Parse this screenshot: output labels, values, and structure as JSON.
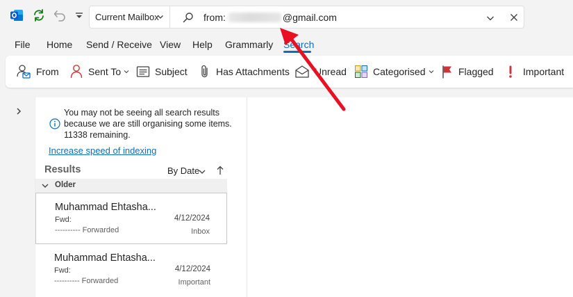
{
  "colors": {
    "accent": "#0f6cbd",
    "annotation_red": "#e81123",
    "outlook_blue": "#0a5fc6",
    "sync_green": "#107c10",
    "flag_red": "#d13438"
  },
  "titlebar": {
    "mailbox_scope": "Current Mailbox",
    "search": {
      "prefix": "from:",
      "redacted_part": "",
      "suffix": "@gmail.com"
    }
  },
  "menu": {
    "tabs": [
      "File",
      "Home",
      "Send / Receive",
      "View",
      "Help",
      "Grammarly",
      "Search"
    ],
    "active": "Search"
  },
  "ribbon": {
    "from": "From",
    "sent_to": "Sent To",
    "subject": "Subject",
    "has_attachments": "Has Attachments",
    "unread": "Unread",
    "categorised": "Categorised",
    "flagged": "Flagged",
    "important": "Important"
  },
  "list": {
    "info_message": "You may not be seeing all search results because we are still organising some items. 11338 remaining.",
    "speed_link": "Increase speed of indexing",
    "results_title": "Results",
    "sort_label": "By Date",
    "group_label": "Older",
    "messages": [
      {
        "sender": "Muhammad Ehtasha...",
        "subject": "Fwd:",
        "date": "4/12/2024",
        "preview": "---------- Forwarded",
        "folder": "Inbox"
      },
      {
        "sender": "Muhammad Ehtasha...",
        "subject": "Fwd:",
        "date": "4/12/2024",
        "preview": "---------- Forwarded",
        "folder": "Important"
      }
    ]
  }
}
